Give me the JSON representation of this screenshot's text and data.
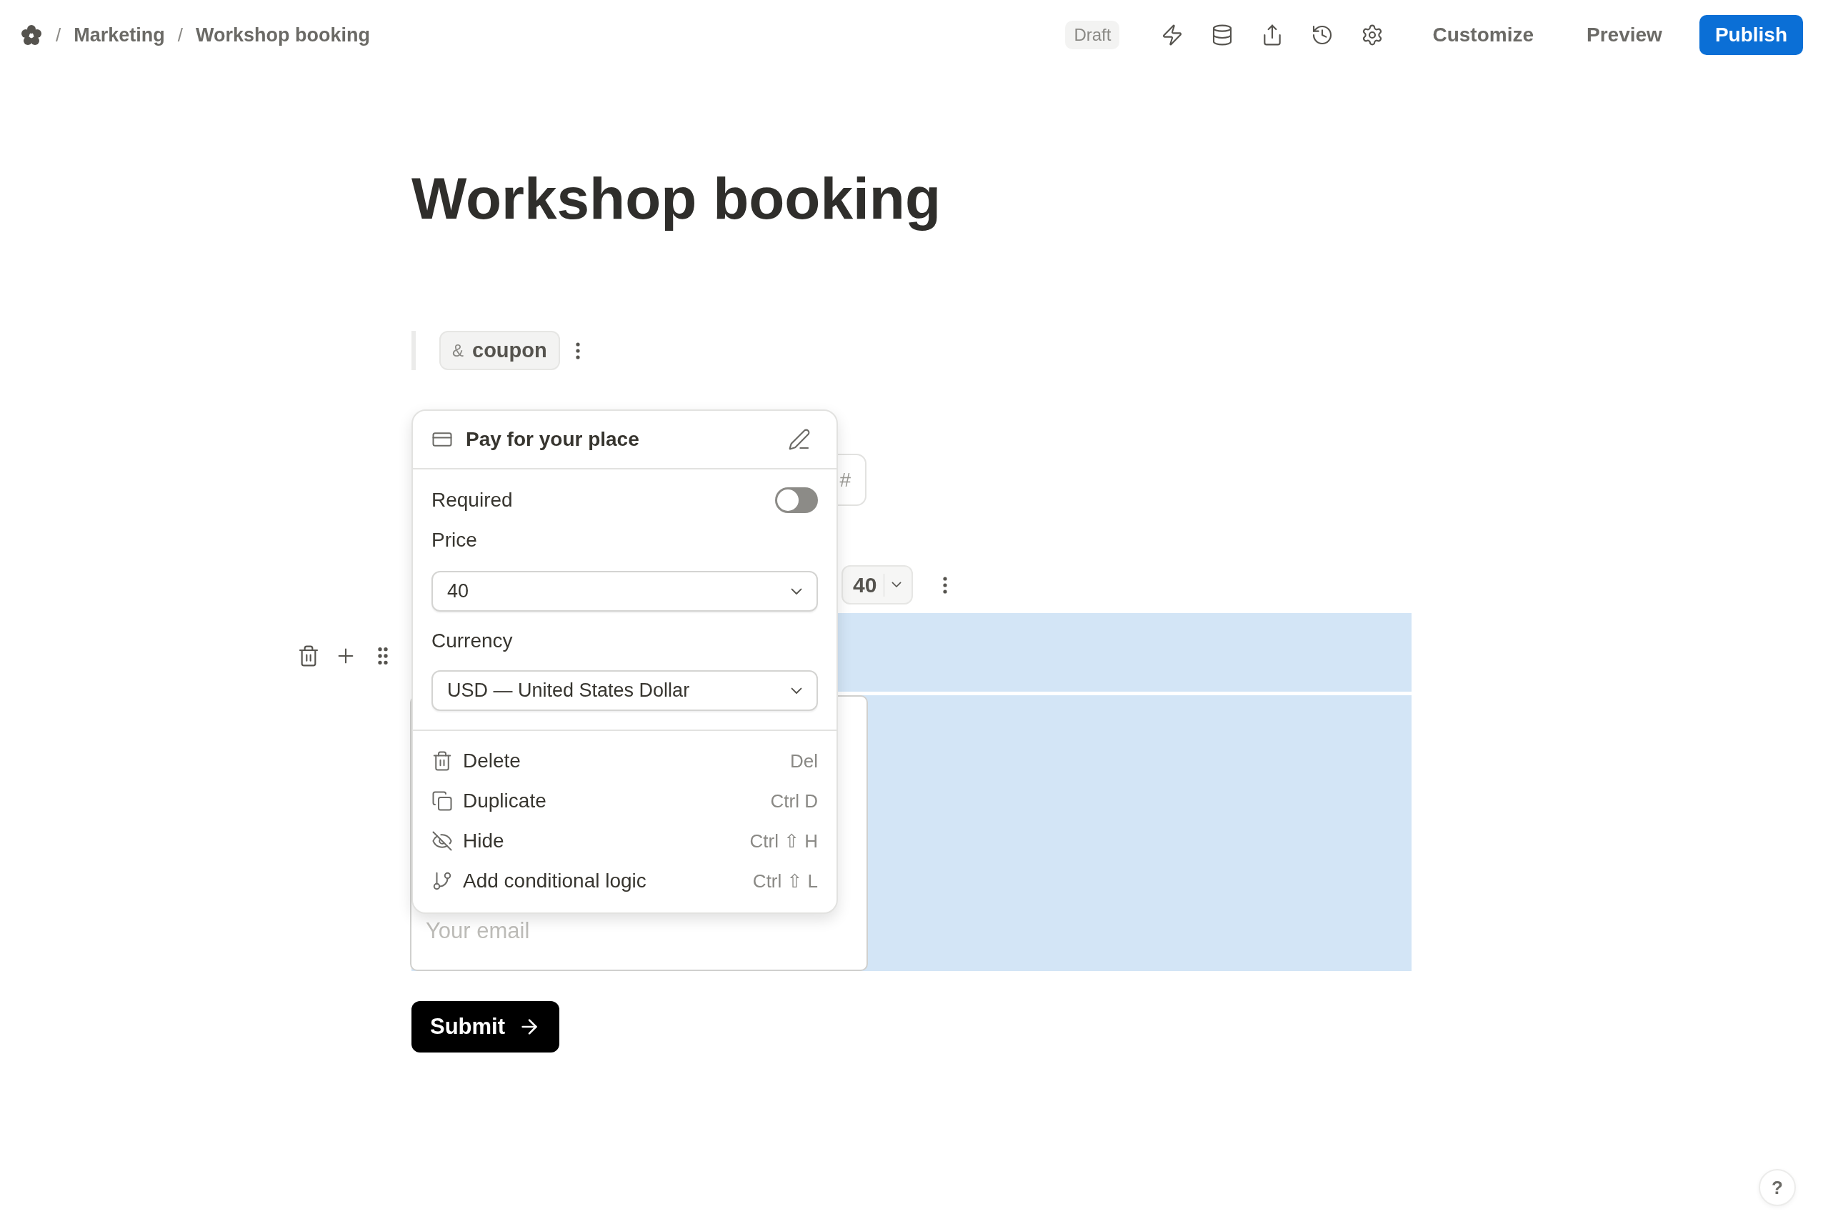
{
  "breadcrumb": [
    {
      "separator": "/",
      "label": "Marketing"
    },
    {
      "separator": "/",
      "label": "Workshop booking"
    }
  ],
  "status": "Draft",
  "actions": [
    {
      "label": "Customize",
      "kind": "plain"
    },
    {
      "label": "Preview",
      "kind": "plain"
    },
    {
      "label": "Publish",
      "kind": "primary"
    }
  ],
  "title": "Workshop booking",
  "coupon_chip": {
    "symbol": "&",
    "label": "coupon"
  },
  "number_field": {
    "suffix": "#"
  },
  "price_chip": {
    "value": "40"
  },
  "email_field": {
    "placeholder": "Your email"
  },
  "submit": {
    "label": "Submit"
  },
  "popup": {
    "title": "Pay for your place",
    "required": {
      "label": "Required",
      "on": false
    },
    "price": {
      "label": "Price",
      "value": "40"
    },
    "currency": {
      "label": "Currency",
      "value": "USD — United States Dollar"
    },
    "menu": [
      {
        "kind": "delete",
        "label": "Delete",
        "shortcut": "Del"
      },
      {
        "kind": "duplicate",
        "label": "Duplicate",
        "shortcut": "Ctrl D"
      },
      {
        "kind": "hide",
        "label": "Hide",
        "shortcut": "Ctrl ⇧ H"
      },
      {
        "kind": "logic",
        "label": "Add conditional logic",
        "shortcut": "Ctrl ⇧ L"
      }
    ]
  },
  "help": "?"
}
